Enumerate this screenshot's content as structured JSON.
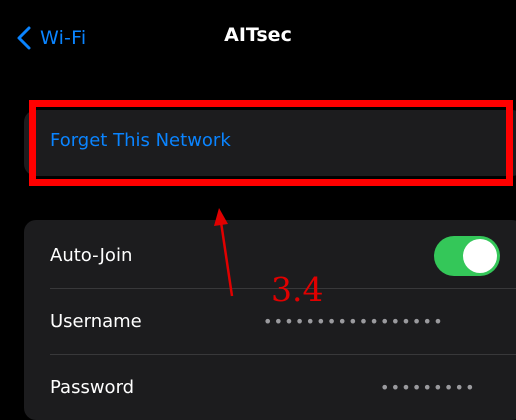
{
  "nav": {
    "back_label": "Wi-Fi",
    "title": "AITsec"
  },
  "actions": {
    "forget_label": "Forget This Network"
  },
  "settings": {
    "auto_join_label": "Auto-Join",
    "auto_join_on": true,
    "username_label": "Username",
    "username_value": "•••••••••••••••••",
    "password_label": "Password",
    "password_value": "•••••••••"
  },
  "annotation": {
    "step_label": "3.4"
  },
  "colors": {
    "accent": "#0a84ff",
    "toggle_on": "#34c759",
    "highlight": "#ff0000",
    "annotation": "#e00000"
  },
  "icons": {
    "back": "chevron-left-icon"
  }
}
